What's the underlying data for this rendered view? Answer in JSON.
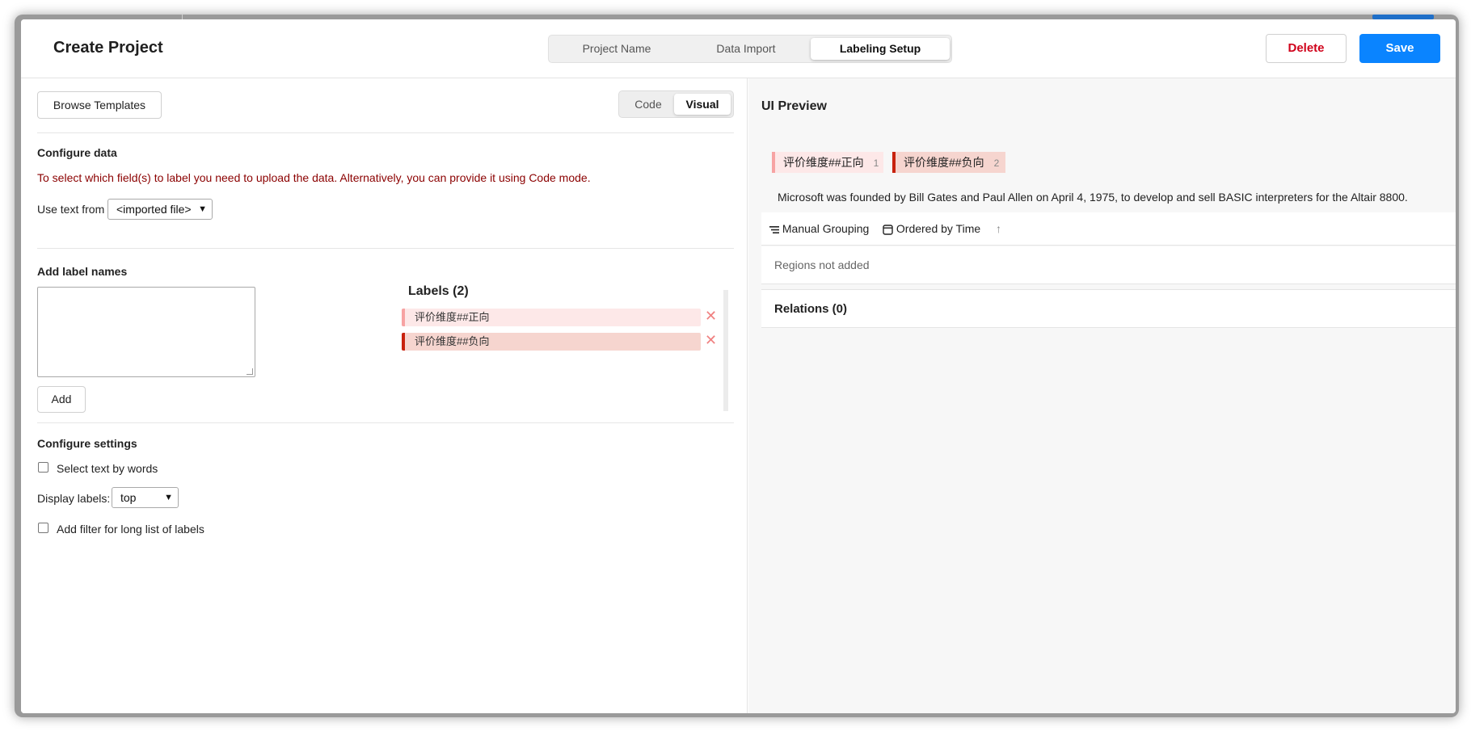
{
  "header": {
    "title": "Create Project",
    "steps": [
      "Project Name",
      "Data Import",
      "Labeling Setup"
    ],
    "active_step": "Labeling Setup",
    "delete_label": "Delete",
    "save_label": "Save"
  },
  "left": {
    "browse_label": "Browse Templates",
    "mode_code": "Code",
    "mode_visual": "Visual",
    "configure_data": {
      "title": "Configure data",
      "warning": "To select which field(s) to label you need to upload the data. Alternatively, you can provide it using Code mode.",
      "use_text_label": "Use text from",
      "use_text_value": "<imported file>"
    },
    "add_label": {
      "title": "Add label names",
      "textarea_value": "",
      "add_label": "Add"
    },
    "labels": {
      "title": "Labels (2)",
      "items": [
        {
          "name": "评价维度##正向",
          "color": "#f7a3a3"
        },
        {
          "name": "评价维度##负向",
          "color": "#c8220e"
        }
      ]
    },
    "settings": {
      "title": "Configure settings",
      "select_by_words": "Select text by words",
      "display_labels_label": "Display labels:",
      "display_labels_value": "top",
      "filter_label": "Add filter for long list of labels"
    }
  },
  "preview": {
    "title": "UI Preview",
    "chips": [
      {
        "name": "评价维度##正向",
        "hotkey": "1"
      },
      {
        "name": "评价维度##负向",
        "hotkey": "2"
      }
    ],
    "text": "Microsoft was founded by Bill Gates and Paul Allen on April 4, 1975, to develop and sell BASIC interpreters for the Altair 8800.",
    "grouping": "Manual Grouping",
    "ordering": "Ordered by Time",
    "regions_empty": "Regions not added",
    "relations": "Relations (0)"
  },
  "colors": {
    "accent": "#0a84ff",
    "danger": "#d0021b",
    "warning_text": "#8b0000"
  }
}
